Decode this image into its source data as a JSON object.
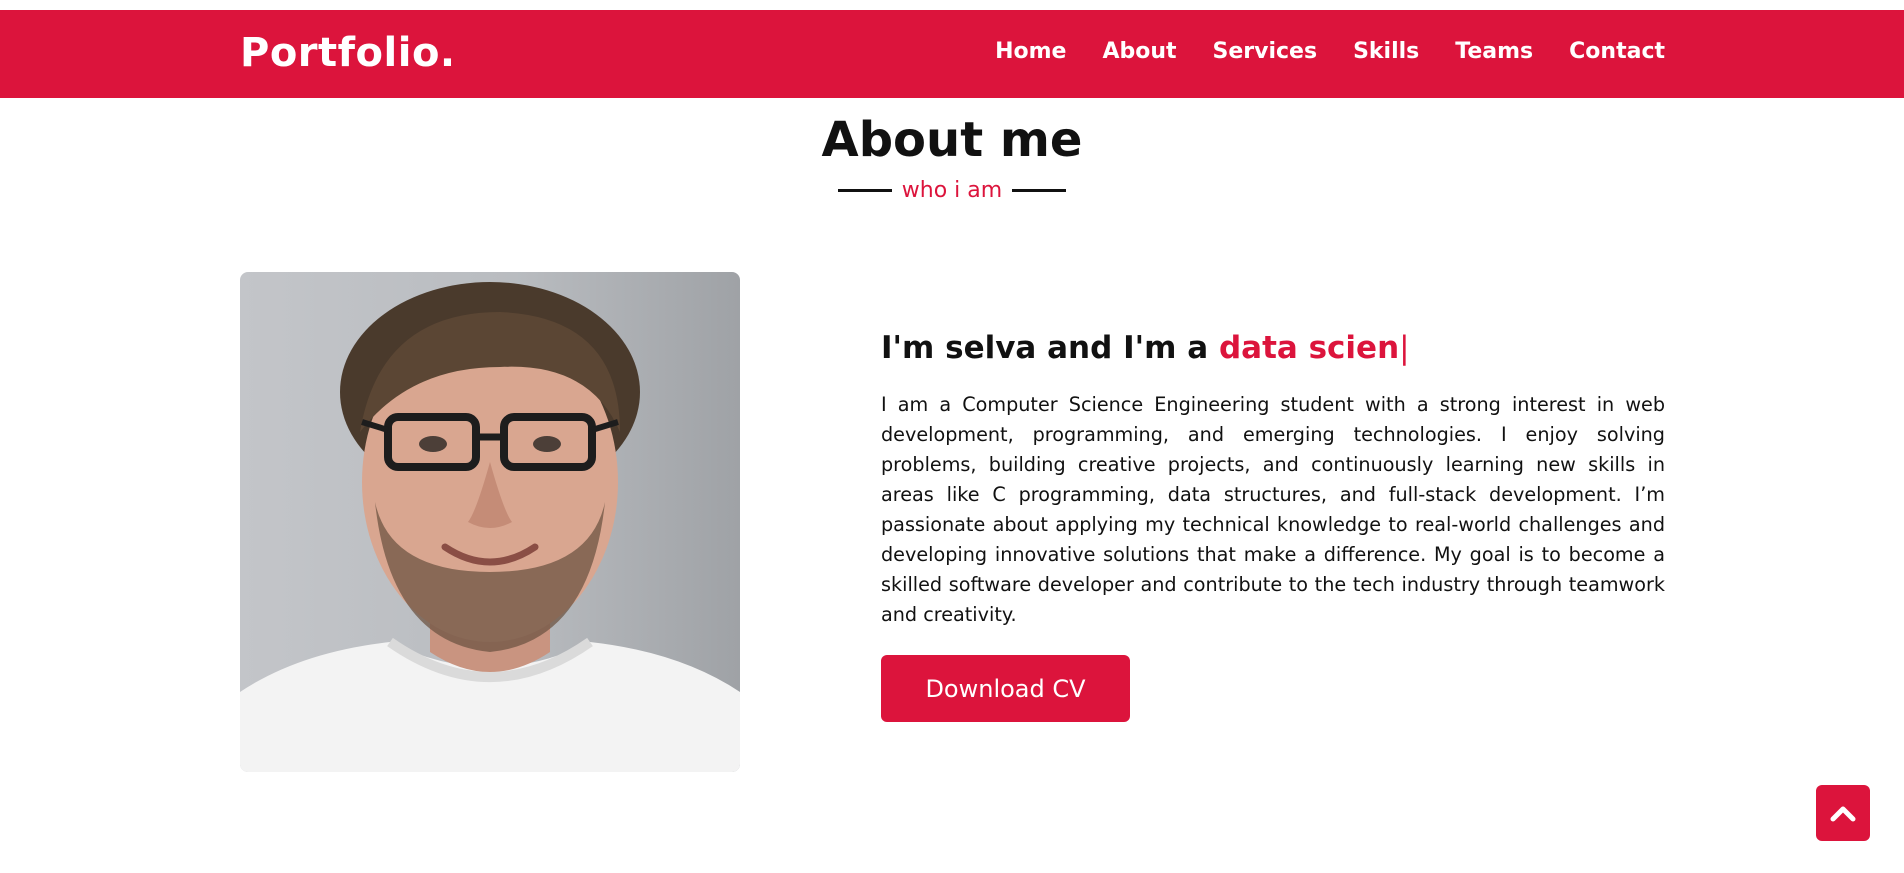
{
  "brand": {
    "logo": "Portfolio."
  },
  "nav": {
    "items": [
      "Home",
      "About",
      "Services",
      "Skills",
      "Teams",
      "Contact"
    ]
  },
  "about": {
    "title": "About me",
    "subtitle": "who i am",
    "intro_prefix": "I'm selva and I'm a ",
    "intro_typed": "data scien",
    "caret": "|",
    "bio": "I am a Computer Science Engineering student with a strong interest in web development, programming, and emerging technologies. I enjoy solving problems, building creative projects, and continuously learning new skills in areas like C programming, data structures, and full-stack development. I’m passionate about applying my technical knowledge to real-world challenges and developing innovative solutions that make a difference. My goal is to become a skilled software developer and contribute to the tech industry through teamwork and creativity.",
    "cv_button": "Download CV",
    "photo_icon": "profile-photo"
  },
  "scroll_top": {
    "icon": "chevron-up-icon"
  },
  "colors": {
    "accent": "#dc143c",
    "text": "#111111",
    "background": "#ffffff"
  }
}
